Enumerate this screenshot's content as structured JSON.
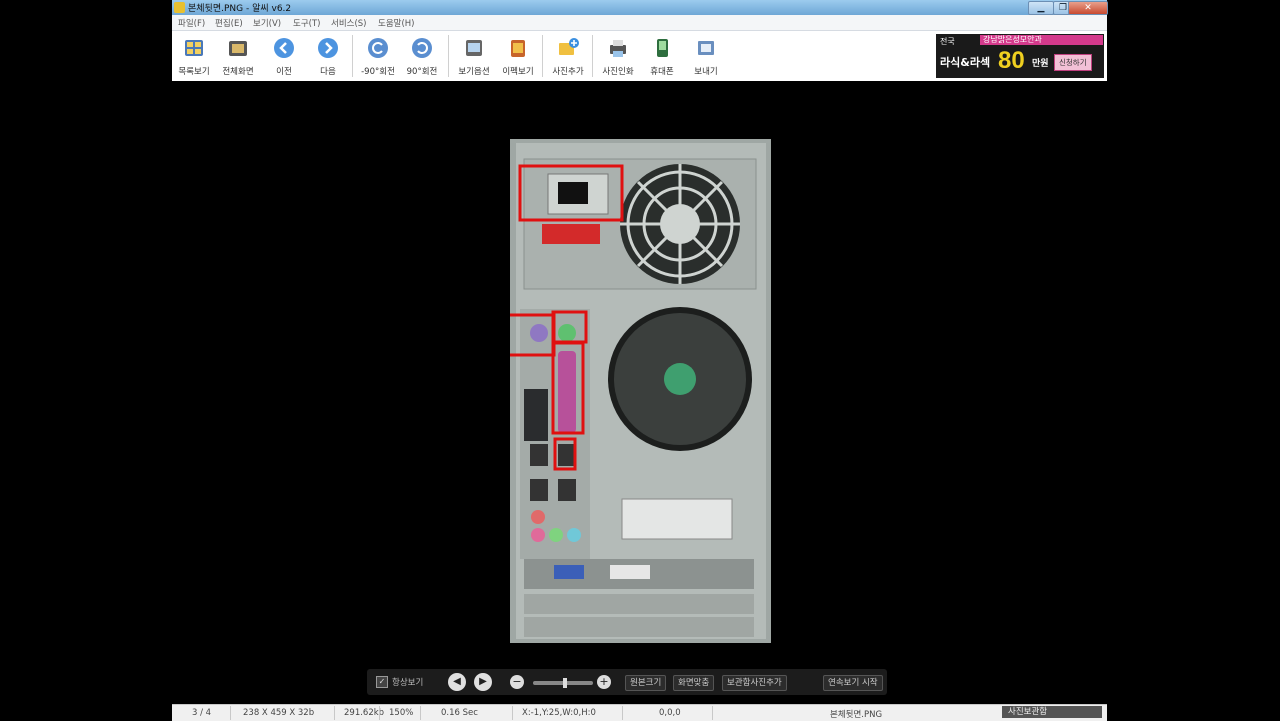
{
  "window": {
    "title": "본체뒷면.PNG - 알씨 v6.2"
  },
  "menu": [
    "파일(F)",
    "편집(E)",
    "보기(V)",
    "도구(T)",
    "서비스(S)",
    "도움말(H)"
  ],
  "toolbar": {
    "list_view": "목록보기",
    "fullscreen": "전체화면",
    "prev": "이전",
    "next": "다음",
    "rotate_ccw": "-90°회전",
    "rotate_cw": "90°회전",
    "view_options": "보기옵션",
    "effect_view": "이펙보기",
    "add_photo": "사진추가",
    "print_photo": "사진인화",
    "phone": "휴대폰",
    "send": "보내기"
  },
  "ad": {
    "region": "전국",
    "clinic": "강남밝은성모안과",
    "procedure": "라식&라섹",
    "price_number": "80",
    "price_unit": "만원",
    "apply": "신청하기"
  },
  "viewer_controls": {
    "always_show": "항상보기",
    "original_size": "원본크기",
    "fit_screen": "화면맞춤",
    "save_add": "보관함사진추가",
    "slideshow": "연속보기 시작"
  },
  "status": {
    "index": "3 / 4",
    "dimensions": "238 X 459 X 32b",
    "filesize": "291.62kb",
    "zoom": "150%",
    "time": "0.16 Sec",
    "coords": "X:-1,Y:25,W:0,H:0",
    "offset": "0,0,0",
    "filename": "본체뒷면.PNG",
    "album": "사진보관함"
  },
  "colors": {
    "highlight": "#e01010",
    "accent": "#3a8fe0"
  }
}
